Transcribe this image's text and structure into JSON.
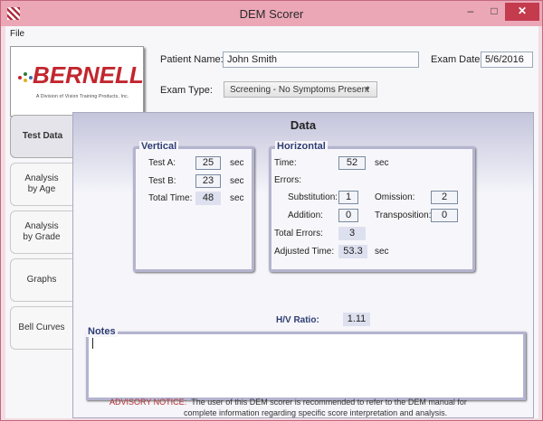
{
  "window": {
    "title": "DEM Scorer",
    "minimize": "–",
    "maximize": "□",
    "close": "✕"
  },
  "menu": {
    "file": "File"
  },
  "logo": {
    "brand": "BERNELL",
    "tagline": "A Division of Vision Training Products, Inc."
  },
  "header": {
    "patient_label": "Patient Name:",
    "patient_value": "John Smith",
    "exam_date_label": "Exam Date:",
    "exam_date_value": "5/6/2016",
    "exam_type_label": "Exam Type:",
    "exam_type_value": "Screening - No Symptoms Present"
  },
  "tabs": [
    {
      "label": "Test Data",
      "active": true
    },
    {
      "label": "Analysis by Age"
    },
    {
      "label": "Analysis by Grade"
    },
    {
      "label": "Graphs"
    },
    {
      "label": "Bell Curves"
    }
  ],
  "panel": {
    "title": "Data"
  },
  "vertical": {
    "title": "Vertical",
    "test_a_label": "Test A:",
    "test_a": "25",
    "test_b_label": "Test B:",
    "test_b": "23",
    "total_label": "Total Time:",
    "total": "48",
    "unit": "sec"
  },
  "horizontal": {
    "title": "Horizontal",
    "time_label": "Time:",
    "time": "52",
    "unit": "sec",
    "errors_label": "Errors:",
    "substitution_label": "Substitution:",
    "substitution": "1",
    "omission_label": "Omission:",
    "omission": "2",
    "addition_label": "Addition:",
    "addition": "0",
    "transposition_label": "Transposition:",
    "transposition": "0",
    "total_errors_label": "Total Errors:",
    "total_errors": "3",
    "adjusted_label": "Adjusted Time:",
    "adjusted": "53.3"
  },
  "ratio": {
    "label": "H/V Ratio:",
    "value": "1.11"
  },
  "notes": {
    "title": "Notes"
  },
  "advisory": {
    "tag": "ADVISORY NOTICE:",
    "line1": "The user of this DEM scorer is recommended to refer to the DEM manual for",
    "line2": "complete information regarding specific score interpretation and analysis."
  },
  "colors": {
    "title_bar": "#eba7b6",
    "close": "#c43b4e",
    "brand_red": "#c2262e",
    "group_title": "#2f3d73"
  }
}
